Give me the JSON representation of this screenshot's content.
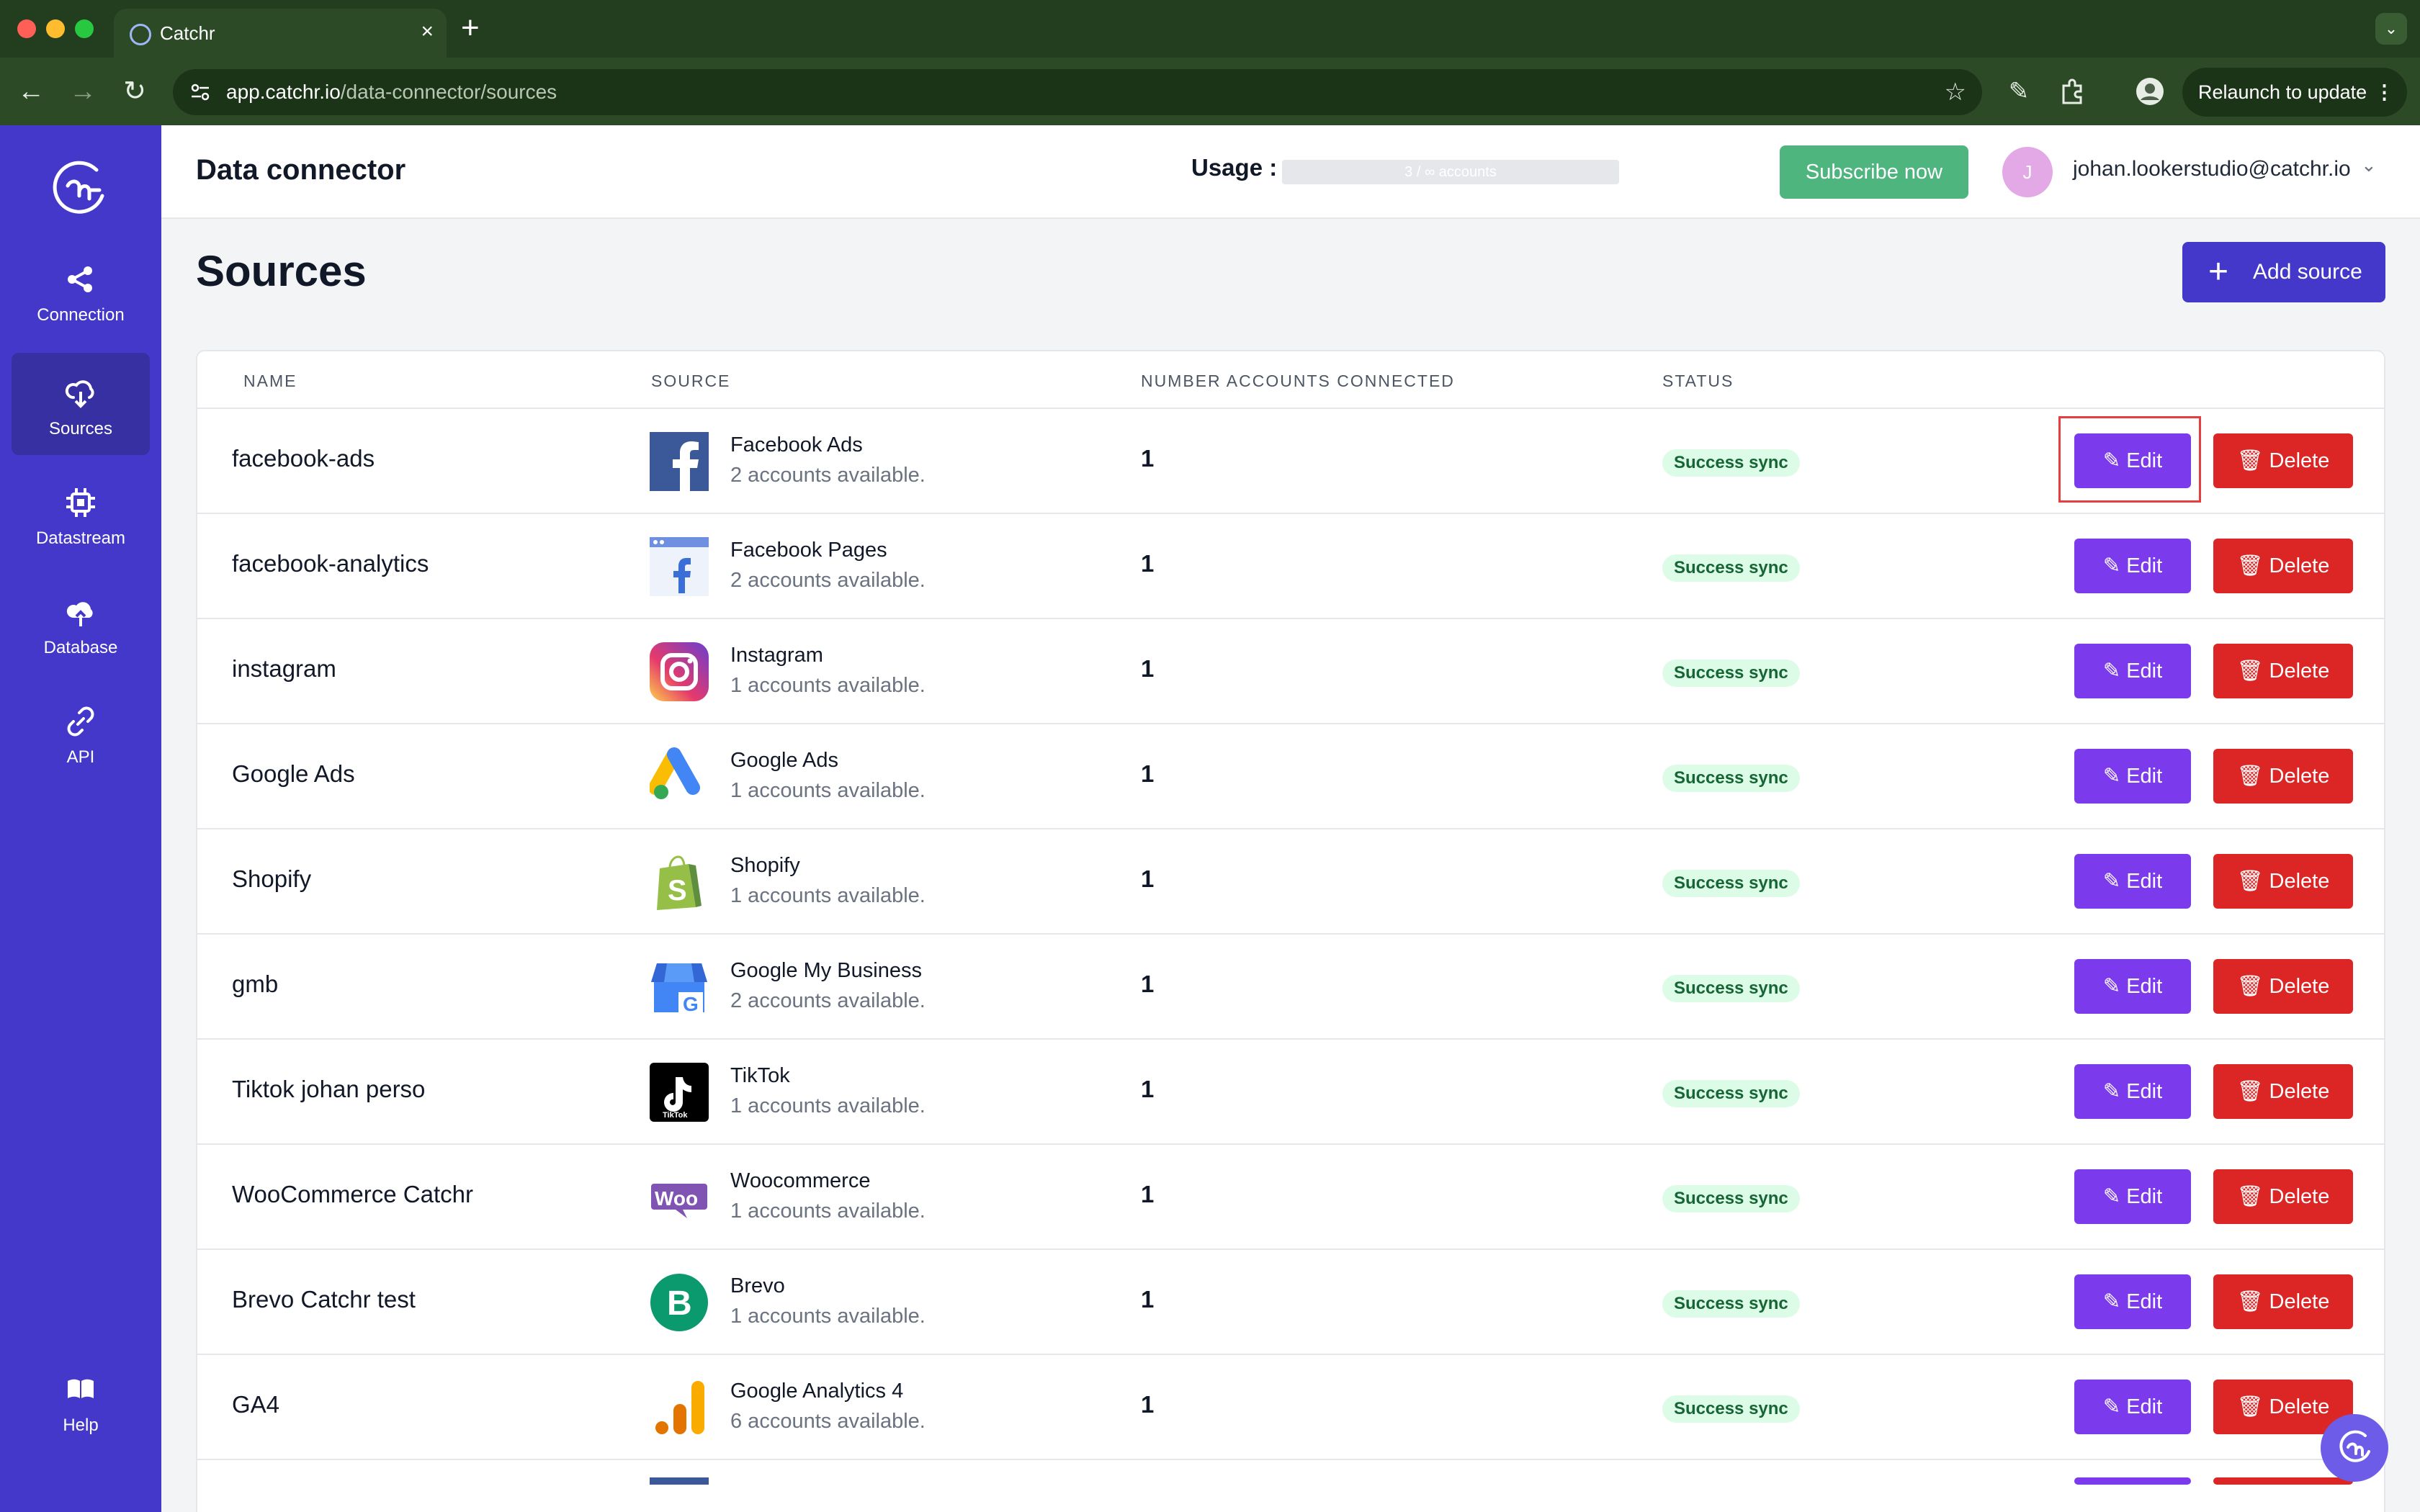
{
  "browser": {
    "tab_title": "Catchr",
    "url_host": "app.catchr.io",
    "url_path": "/data-connector/sources",
    "relaunch_label": "Relaunch to update",
    "icons": [
      "back-icon",
      "forward-icon",
      "reload-icon",
      "site-settings-icon",
      "bookmark-star-icon",
      "pen-icon",
      "extensions-icon",
      "profile-icon",
      "menu-dots-icon"
    ]
  },
  "sidebar": {
    "items": [
      {
        "label": "Connection",
        "icon": "share-icon"
      },
      {
        "label": "Sources",
        "icon": "cloud-download-icon"
      },
      {
        "label": "Datastream",
        "icon": "chip-icon"
      },
      {
        "label": "Database",
        "icon": "cloud-upload-icon"
      },
      {
        "label": "API",
        "icon": "link-icon"
      },
      {
        "label": "Help",
        "icon": "book-icon"
      }
    ],
    "active": "Sources"
  },
  "header": {
    "title": "Data connector",
    "usage_label": "Usage :",
    "usage_text": "3 / ∞ accounts",
    "subscribe_label": "Subscribe now",
    "user_initial": "J",
    "user_email": "johan.lookerstudio@catchr.io"
  },
  "page": {
    "title": "Sources",
    "add_label": "Add source"
  },
  "table": {
    "headers": [
      "NAME",
      "SOURCE",
      "NUMBER ACCOUNTS CONNECTED",
      "STATUS"
    ],
    "edit_label": "Edit",
    "delete_label": "Delete",
    "rows": [
      {
        "name": "facebook-ads",
        "source": "Facebook Ads",
        "available": "2 accounts available.",
        "count": "1",
        "status": "Success sync",
        "logo": "facebook-ads-logo"
      },
      {
        "name": "facebook-analytics",
        "source": "Facebook Pages",
        "available": "2 accounts available.",
        "count": "1",
        "status": "Success sync",
        "logo": "facebook-pages-logo"
      },
      {
        "name": "instagram",
        "source": "Instagram",
        "available": "1 accounts available.",
        "count": "1",
        "status": "Success sync",
        "logo": "instagram-logo"
      },
      {
        "name": "Google Ads",
        "source": "Google Ads",
        "available": "1 accounts available.",
        "count": "1",
        "status": "Success sync",
        "logo": "google-ads-logo"
      },
      {
        "name": "Shopify",
        "source": "Shopify",
        "available": "1 accounts available.",
        "count": "1",
        "status": "Success sync",
        "logo": "shopify-logo"
      },
      {
        "name": "gmb",
        "source": "Google My Business",
        "available": "2 accounts available.",
        "count": "1",
        "status": "Success sync",
        "logo": "google-my-business-logo"
      },
      {
        "name": "Tiktok johan perso",
        "source": "TikTok",
        "available": "1 accounts available.",
        "count": "1",
        "status": "Success sync",
        "logo": "tiktok-logo"
      },
      {
        "name": "WooCommerce Catchr",
        "source": "Woocommerce",
        "available": "1 accounts available.",
        "count": "1",
        "status": "Success sync",
        "logo": "woocommerce-logo"
      },
      {
        "name": "Brevo Catchr test",
        "source": "Brevo",
        "available": "1 accounts available.",
        "count": "1",
        "status": "Success sync",
        "logo": "brevo-logo"
      },
      {
        "name": "GA4",
        "source": "Google Analytics 4",
        "available": "6 accounts available.",
        "count": "1",
        "status": "Success sync",
        "logo": "google-analytics-4-logo"
      }
    ]
  },
  "colors": {
    "sidebar": "#4338ca",
    "sidebar_active": "#3730a3",
    "edit": "#7c3aed",
    "delete": "#dc2626",
    "subscribe": "#4fb57f",
    "status_bg": "#dcfce7",
    "status_text": "#166534",
    "highlight": "#e53e3e"
  }
}
